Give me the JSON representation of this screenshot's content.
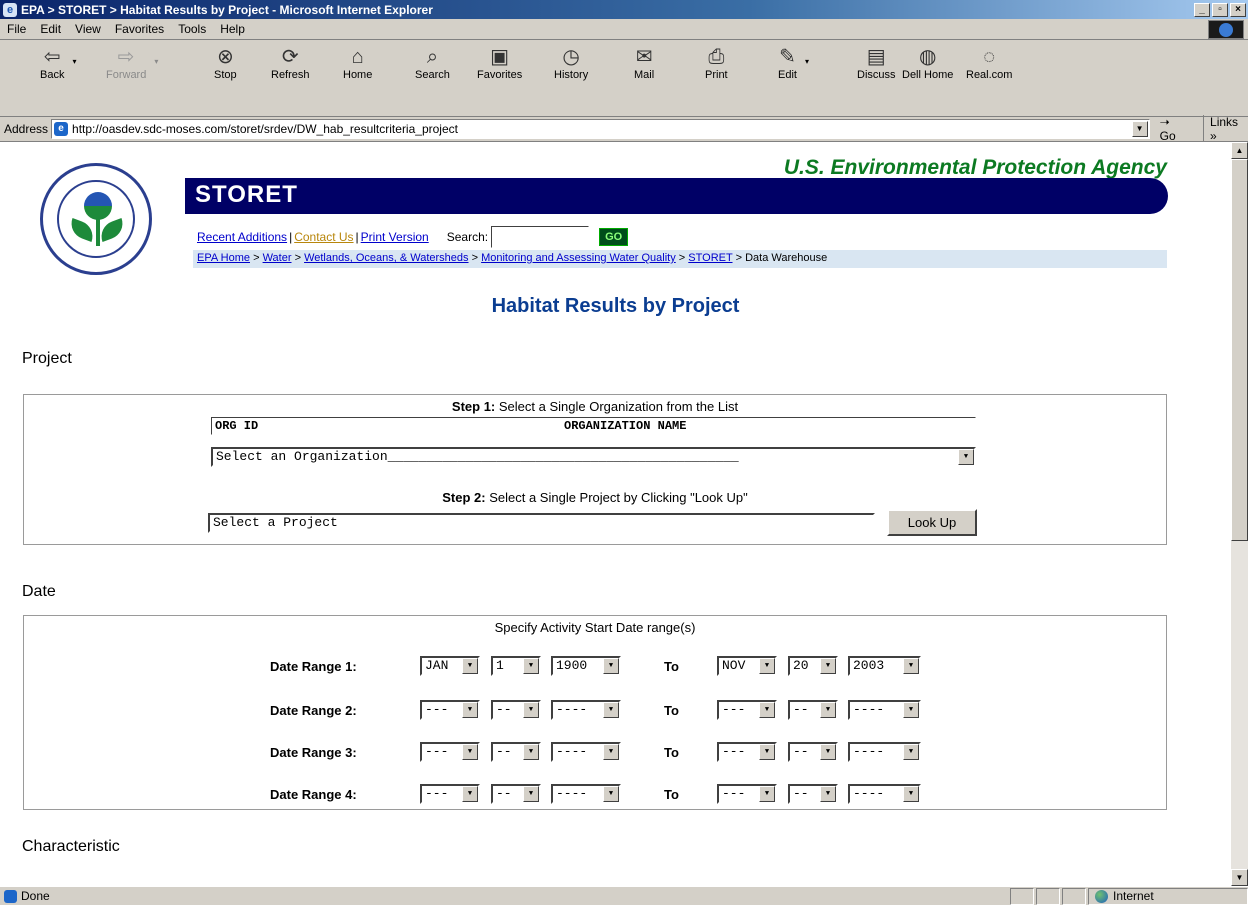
{
  "window": {
    "title": "EPA > STORET > Habitat Results by Project - Microsoft Internet Explorer",
    "buttons": [
      "_",
      "▫",
      "×"
    ]
  },
  "menu": [
    "File",
    "Edit",
    "View",
    "Favorites",
    "Tools",
    "Help"
  ],
  "toolbar": {
    "back": "Back",
    "forward": "Forward",
    "stop": "Stop",
    "refresh": "Refresh",
    "home": "Home",
    "search": "Search",
    "favorites": "Favorites",
    "history": "History",
    "mail": "Mail",
    "print": "Print",
    "edit": "Edit",
    "discuss": "Discuss",
    "dellhome": "Dell Home",
    "realcom": "Real.com"
  },
  "address": {
    "label": "Address",
    "url": "http://oasdev.sdc-moses.com/storet/srdev/DW_hab_resultcriteria_project",
    "go": "Go",
    "links": "Links"
  },
  "header": {
    "agency": "U.S. Environmental Protection Agency",
    "storet": "STORET",
    "links": {
      "recent": "Recent Additions",
      "sep": "|",
      "contact": "Contact Us",
      "print": "Print Version",
      "search_label": "Search:",
      "go": "GO"
    },
    "breadcrumb": {
      "home": "EPA Home",
      "water": "Water",
      "wetlands": "Wetlands, Oceans, & Watersheds",
      "monitoring": "Monitoring and Assessing Water Quality",
      "storet": "STORET",
      "current": "Data Warehouse",
      "sep": ">"
    }
  },
  "page": {
    "title": "Habitat Results by Project",
    "project_heading": "Project",
    "step1_bold": "Step 1:",
    "step1_text": "Select a Single Organization from the List",
    "org_col1": "ORG ID",
    "org_col2": "ORGANIZATION NAME",
    "org_select": "Select an Organization_____________________________________________",
    "step2_bold": "Step 2:",
    "step2_text": "Select a Single Project by Clicking \"Look Up\"",
    "project_field": "Select a Project",
    "lookup": "Look Up",
    "date_heading": "Date",
    "date_caption": "Specify Activity Start Date range(s)",
    "to": "To",
    "ranges": [
      {
        "label": "Date Range 1:",
        "from": [
          "JAN",
          "1",
          "1900"
        ],
        "to": [
          "NOV",
          "20",
          "2003"
        ]
      },
      {
        "label": "Date Range 2:",
        "from": [
          "---",
          "--",
          "----"
        ],
        "to": [
          "---",
          "--",
          "----"
        ]
      },
      {
        "label": "Date Range 3:",
        "from": [
          "---",
          "--",
          "----"
        ],
        "to": [
          "---",
          "--",
          "----"
        ]
      },
      {
        "label": "Date Range 4:",
        "from": [
          "---",
          "--",
          "----"
        ],
        "to": [
          "---",
          "--",
          "----"
        ]
      }
    ],
    "characteristic_heading": "Characteristic"
  },
  "status": {
    "text": "Done",
    "zone": "Internet"
  }
}
